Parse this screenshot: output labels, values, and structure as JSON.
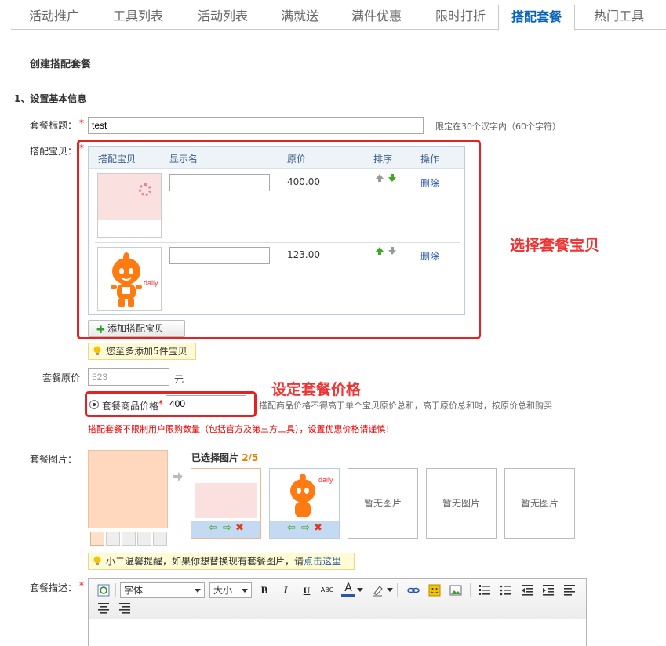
{
  "tabs": [
    {
      "label": "活动推广"
    },
    {
      "label": "工具列表"
    },
    {
      "label": "活动列表"
    },
    {
      "label": "满就送"
    },
    {
      "label": "满件优惠"
    },
    {
      "label": "限时打折"
    },
    {
      "label": "搭配套餐"
    },
    {
      "label": "热门工具"
    }
  ],
  "page_title": "创建搭配套餐",
  "section_title": "1、设置基本信息",
  "title_field": {
    "label": "套餐标题：",
    "value": "test",
    "hint": "限定在30个汉字内（60个字符）"
  },
  "products": {
    "label": "搭配宝贝：",
    "headers": {
      "item": "搭配宝贝",
      "name": "显示名",
      "price": "原价",
      "sort": "排序",
      "action": "操作"
    },
    "rows": [
      {
        "display_name": "",
        "price": "400.00",
        "delete": "删除"
      },
      {
        "display_name": "",
        "price": "123.00",
        "delete": "删除",
        "thumb_text": "daily"
      }
    ],
    "add_button": "添加搭配宝贝",
    "tip": "您至多添加5件宝贝",
    "annotation": "选择套餐宝贝"
  },
  "original_price": {
    "label": "套餐原价",
    "value": "523",
    "unit": "元"
  },
  "package_price": {
    "label": "套餐商品价格",
    "value": "400",
    "hint": "搭配商品价格不得高于单个宝贝原价总和，高于原价总和时，按原价总和购买",
    "annotation": "设定套餐价格"
  },
  "warning": "搭配套餐不限制用户限购数量（包括官方及第三方工具），设置优惠价格请谨慎！",
  "images": {
    "label": "套餐图片：",
    "chosen_title": "已选择图片",
    "chosen_count": "2/5",
    "empty_text": "暂无图片",
    "tip_text": "小二温馨提醒，如果你想替换现有套餐图片，请",
    "tip_link": "点击这里"
  },
  "description": {
    "label": "套餐描述：",
    "font_select": "字体",
    "size_select": "大小"
  },
  "colors": {
    "accent": "#0a65b5",
    "annotation": "#e33333",
    "link": "#2458a8"
  }
}
